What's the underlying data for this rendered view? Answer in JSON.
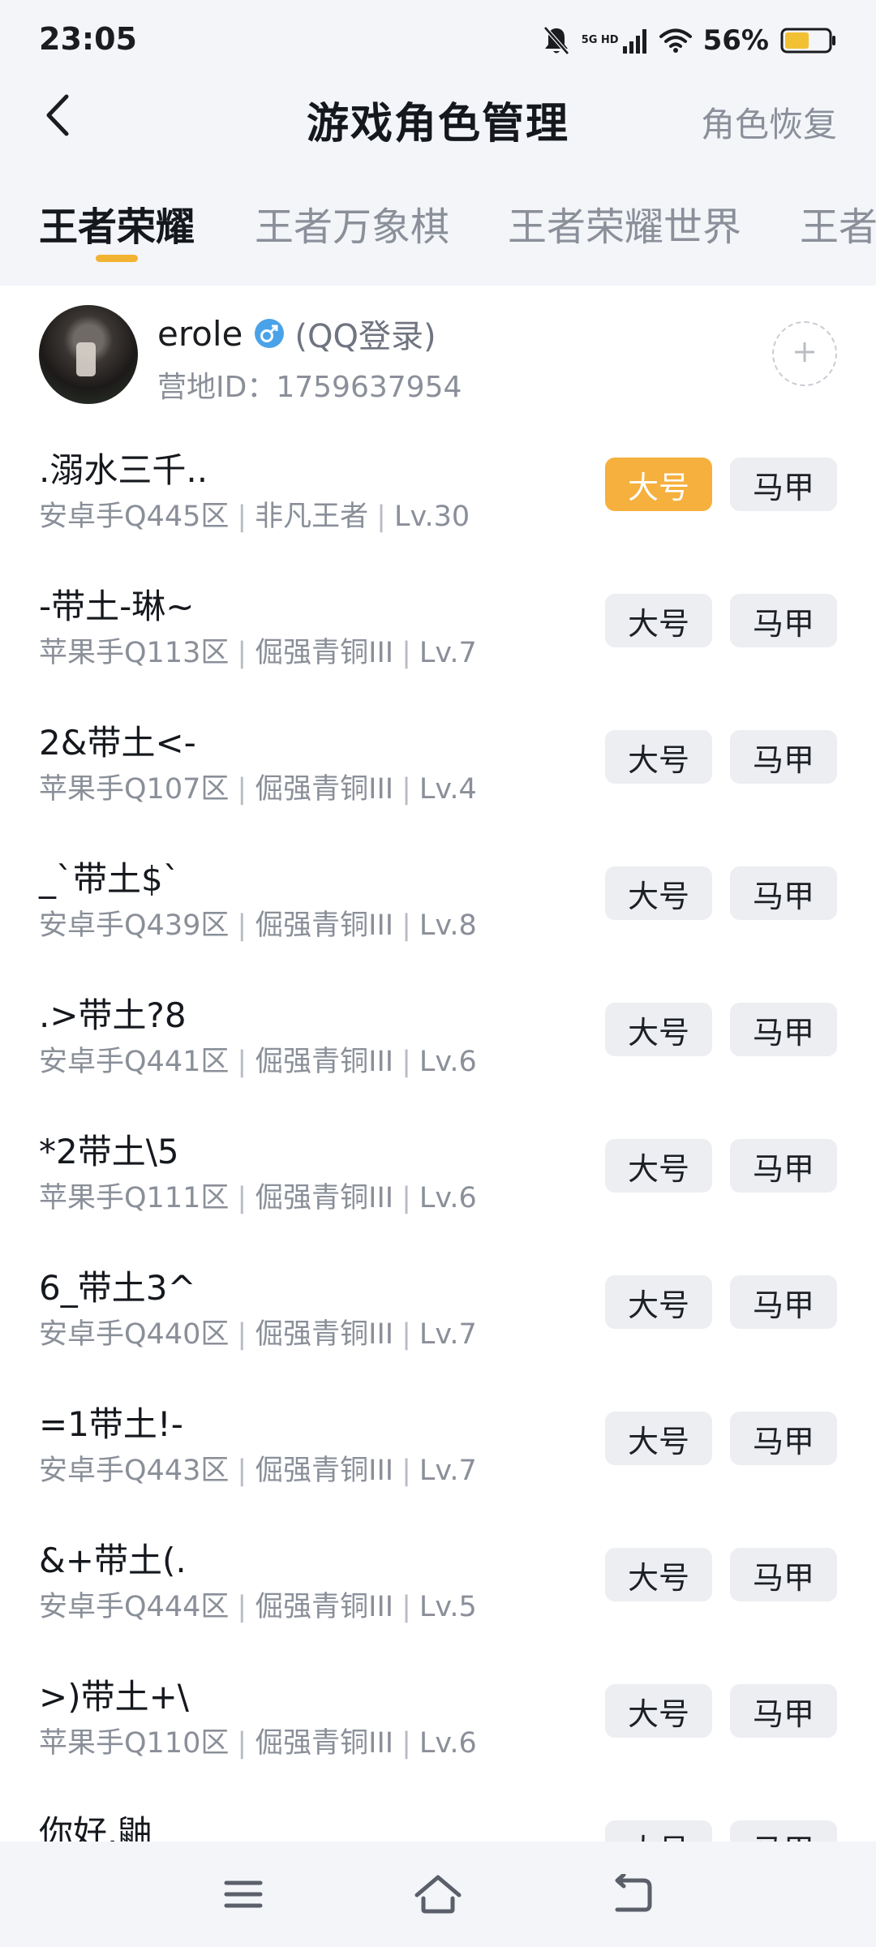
{
  "status_bar": {
    "time": "23:05",
    "network_label_top": "5G HD",
    "battery_percent": "56%",
    "battery_level": 0.56,
    "icons": [
      "bell-muted-icon",
      "signal-icon",
      "wifi-icon",
      "battery-icon"
    ]
  },
  "nav": {
    "back_icon": "chevron-left-icon",
    "title": "游戏角色管理",
    "restore_label": "角色恢复"
  },
  "tabs": [
    {
      "label": "王者荣耀",
      "active": true
    },
    {
      "label": "王者万象棋",
      "active": false
    },
    {
      "label": "王者荣耀世界",
      "active": false
    },
    {
      "label": "王者",
      "active": false
    }
  ],
  "account": {
    "name": "erole",
    "login_type": "(QQ登录)",
    "campus_id_label": "营地ID：",
    "campus_id_value": "1759637954",
    "add_icon": "plus-icon",
    "gender_icon": "male-icon"
  },
  "colors": {
    "accent": "#f5b03d",
    "indicator": "#f2b232",
    "gender_badge": "#4aa3e8",
    "background": "#f3f5f9"
  },
  "tag_labels": {
    "main": "大号",
    "alt": "马甲"
  },
  "roles": [
    {
      "name": ".溺水三千..",
      "platform": "安卓手Q445区",
      "rank": "非凡王者",
      "level": "Lv.30",
      "selected": "main"
    },
    {
      "name": "-带土-琳~",
      "platform": "苹果手Q113区",
      "rank": "倔强青铜III",
      "level": "Lv.7",
      "selected": ""
    },
    {
      "name": "2&带土<-",
      "platform": "苹果手Q107区",
      "rank": "倔强青铜III",
      "level": "Lv.4",
      "selected": ""
    },
    {
      "name": "_`带土$`",
      "platform": "安卓手Q439区",
      "rank": "倔强青铜III",
      "level": "Lv.8",
      "selected": ""
    },
    {
      "name": ".>带土?8",
      "platform": "安卓手Q441区",
      "rank": "倔强青铜III",
      "level": "Lv.6",
      "selected": ""
    },
    {
      "name": "*2带土\\5",
      "platform": "苹果手Q111区",
      "rank": "倔强青铜III",
      "level": "Lv.6",
      "selected": ""
    },
    {
      "name": "6_带土3^",
      "platform": "安卓手Q440区",
      "rank": "倔强青铜III",
      "level": "Lv.7",
      "selected": ""
    },
    {
      "name": "=1带土!-",
      "platform": "安卓手Q443区",
      "rank": "倔强青铜III",
      "level": "Lv.7",
      "selected": ""
    },
    {
      "name": "&+带土(.",
      "platform": "安卓手Q444区",
      "rank": "倔强青铜III",
      "level": "Lv.5",
      "selected": ""
    },
    {
      "name": ">)带土+\\",
      "platform": "苹果手Q110区",
      "rank": "倔强青铜III",
      "level": "Lv.6",
      "selected": ""
    },
    {
      "name": "你好.鼬",
      "platform": "",
      "rank": "",
      "level": "",
      "selected": ""
    }
  ],
  "bottom_nav": {
    "icons": [
      "menu-icon",
      "home-icon",
      "back-nav-icon"
    ]
  }
}
